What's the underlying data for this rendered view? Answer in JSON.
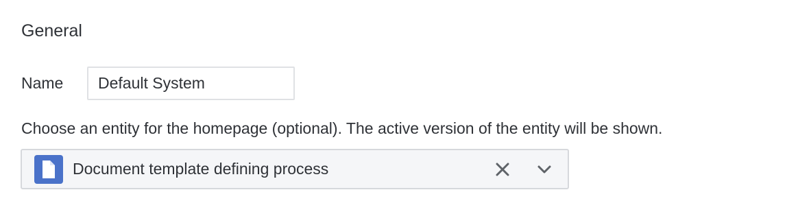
{
  "section": {
    "title": "General"
  },
  "name_field": {
    "label": "Name",
    "value": "Default System"
  },
  "homepage": {
    "hint": "Choose an entity for the homepage (optional). The active version of the entity will be shown.",
    "selected_entity": "Document template defining process",
    "entity_icon": "document-icon",
    "clear_icon": "close-icon",
    "dropdown_icon": "chevron-down-icon"
  },
  "colors": {
    "icon_badge": "#4a72c9",
    "select_background": "#f5f6f8",
    "icon_gray": "#5f6368"
  }
}
